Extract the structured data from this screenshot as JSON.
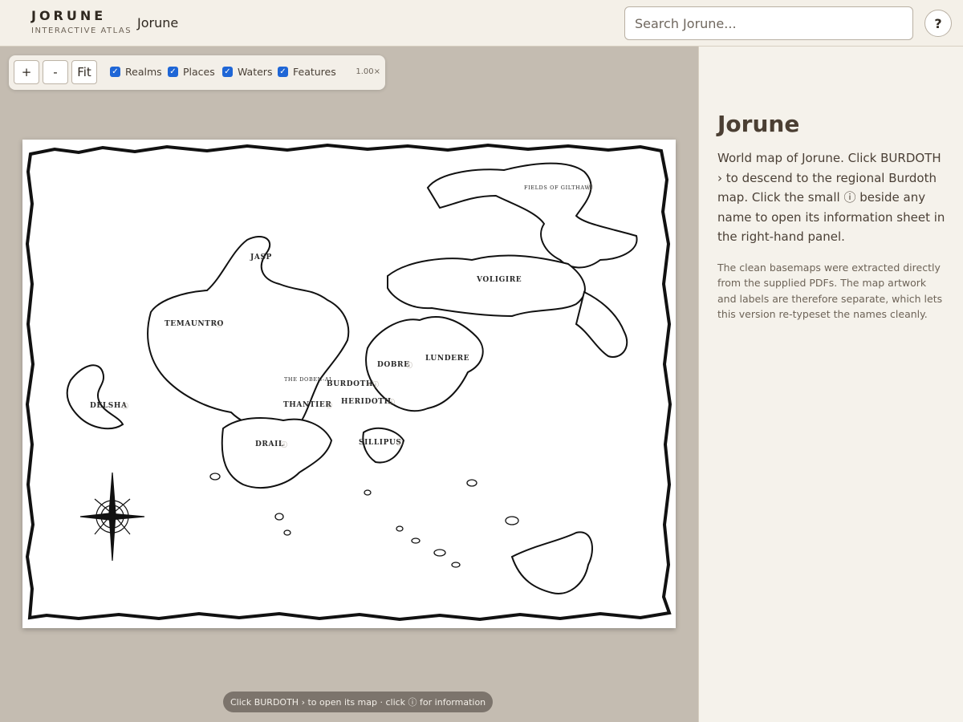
{
  "app": {
    "brand_title": "JORUNE",
    "brand_subtitle": "INTERACTIVE ATLAS",
    "breadcrumb": "Jorune"
  },
  "search": {
    "placeholder": "Search Jorune..."
  },
  "help_label": "?",
  "toolbar": {
    "zoom_in": "+",
    "zoom_out": "-",
    "fit": "Fit",
    "layers": [
      {
        "label": "Realms",
        "checked": true
      },
      {
        "label": "Places",
        "checked": true
      },
      {
        "label": "Waters",
        "checked": true
      },
      {
        "label": "Features",
        "checked": true
      }
    ],
    "zoom_level": "1.00×"
  },
  "map": {
    "labels": {
      "fields_of_gilthaw": "FIELDS OF GILTHAW",
      "jasp": "JASP",
      "voligire": "VOLIGIRE",
      "temauntro": "TEMAUNTRO",
      "dobre": "DOBRE",
      "lundere": "LUNDERE",
      "doben_al": "THE DOBEN-AL",
      "burdoth": "BURDOTH",
      "delsha": "DELSHA",
      "thantier": "THANTIER",
      "heridoth": "HERIDOTH",
      "drail": "DRAIL",
      "sillipus": "SILLIPUS"
    },
    "info_glyph": "ⓘ",
    "descend_glyph": "›"
  },
  "hint": "Click BURDOTH › to open its map · click ⓘ for information",
  "panel": {
    "title": "Jorune",
    "lead": "World map of Jorune. Click BURDOTH › to descend to the regional Burdoth map. Click the small ⓘ beside any name to open its information sheet in the right-hand panel.",
    "note": "The clean basemaps were extracted directly from the supplied PDFs. The map artwork and labels are therefore separate, which lets this version re-typeset the names cleanly."
  }
}
